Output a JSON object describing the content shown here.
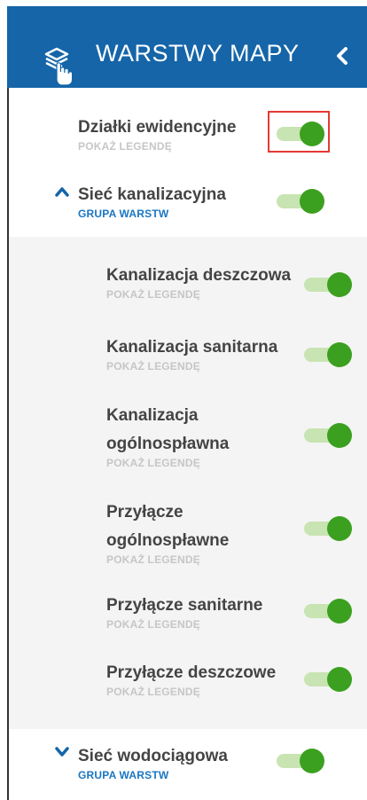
{
  "header": {
    "title": "WARSTWY MAPY",
    "layers_icon": "layers-hand-icon",
    "collapse_icon": "chevron-left-icon"
  },
  "layers": [
    {
      "name": "Działki ewidencyjne",
      "sub": "POKAŻ LEGENDĘ",
      "enabled": true
    },
    {
      "name": "Sieć kanalizacyjna",
      "sub": "GRUPA WARSTW",
      "enabled": true,
      "expanded": true
    }
  ],
  "sublayers": [
    {
      "name": "Kanalizacja deszczowa",
      "sub": "POKAŻ LEGENDĘ",
      "enabled": true
    },
    {
      "name": "Kanalizacja sanitarna",
      "sub": "POKAŻ LEGENDĘ",
      "enabled": true
    },
    {
      "name_line1": "Kanalizacja",
      "name_line2": "ogólnospławna",
      "sub": "POKAŻ LEGENDĘ",
      "enabled": true
    },
    {
      "name_line1": "Przyłącze",
      "name_line2": "ogólnospławne",
      "sub": "POKAŻ LEGENDĘ",
      "enabled": true
    },
    {
      "name": "Przyłącze sanitarne",
      "sub": "POKAŻ LEGENDĘ",
      "enabled": true
    },
    {
      "name": "Przyłącze deszczowe",
      "sub": "POKAŻ LEGENDĘ",
      "enabled": true
    }
  ],
  "group2": {
    "name": "Sieć wodociągowa",
    "sub": "GRUPA WARSTW",
    "enabled": true,
    "expanded": false
  },
  "colors": {
    "header_bg": "#1565a8",
    "toggle_on": "#3ba01f",
    "toggle_track": "#c8e4b2",
    "group_label": "#1976c2",
    "highlight_border": "#e53935"
  }
}
